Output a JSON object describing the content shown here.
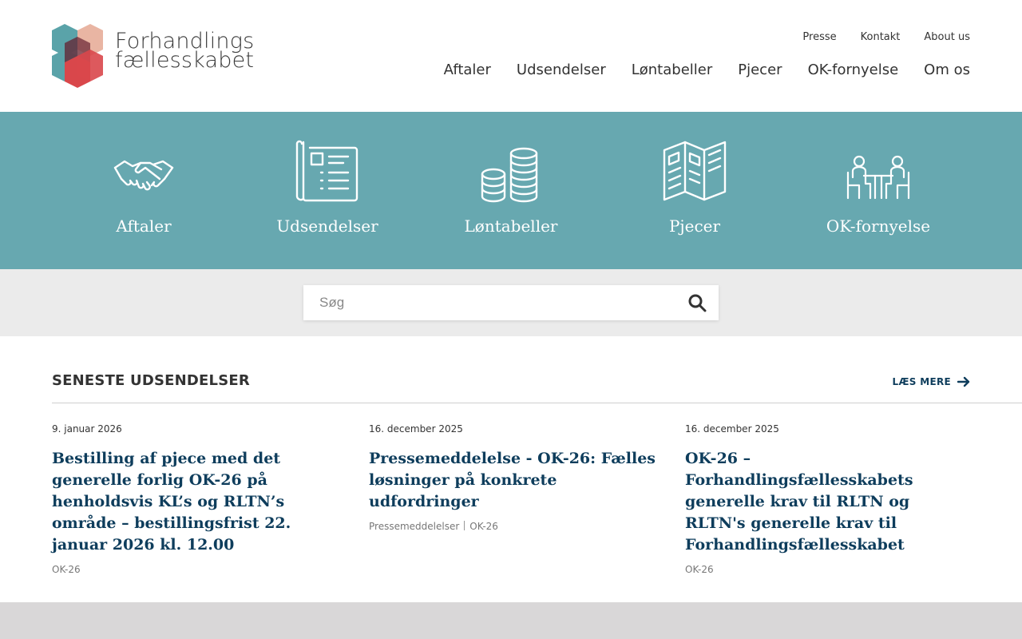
{
  "brand": {
    "name_line1": "Forhandlings",
    "name_line2": "fællesskabet"
  },
  "util_nav": [
    {
      "label": "Presse"
    },
    {
      "label": "Kontakt"
    },
    {
      "label": "About us"
    }
  ],
  "main_nav": [
    {
      "label": "Aftaler"
    },
    {
      "label": "Udsendelser"
    },
    {
      "label": "Løntabeller"
    },
    {
      "label": "Pjecer"
    },
    {
      "label": "OK-fornyelse"
    },
    {
      "label": "Om os"
    }
  ],
  "tiles": [
    {
      "label": "Aftaler",
      "icon": "handshake-icon"
    },
    {
      "label": "Udsendelser",
      "icon": "documents-icon"
    },
    {
      "label": "Løntabeller",
      "icon": "coins-icon"
    },
    {
      "label": "Pjecer",
      "icon": "brochure-icon"
    },
    {
      "label": "OK-fornyelse",
      "icon": "meeting-icon"
    }
  ],
  "search": {
    "placeholder": "Søg",
    "icon": "search-icon"
  },
  "latest": {
    "title": "SENESTE UDSENDELSER",
    "read_more": "LÆS MERE",
    "items": [
      {
        "date": "9. januar 2026",
        "title": "Bestilling af pjece med det generelle forlig OK-26 på henholdsvis KL’s og RLTN’s område – bestillingsfrist 22. januar 2026 kl. 12.00",
        "tags": [
          "OK-26"
        ]
      },
      {
        "date": "16. december 2025",
        "title": "Pressemeddelelse - OK-26: Fælles løsninger på konkrete udfordringer",
        "tags": [
          "Pressemeddelelser",
          "OK-26"
        ]
      },
      {
        "date": "16. december 2025",
        "title": "OK-26 – Forhandlingsfællesskabets generelle krav til RLTN og RLTN's generelle krav til Forhandlingsfællesskabet",
        "tags": [
          "OK-26"
        ]
      }
    ]
  },
  "colors": {
    "band": "#67a8b0",
    "link": "#0e3d5c",
    "logo_teal": "#5aa3a9",
    "logo_red": "#d9474b",
    "logo_peach": "#e9b5a3"
  }
}
